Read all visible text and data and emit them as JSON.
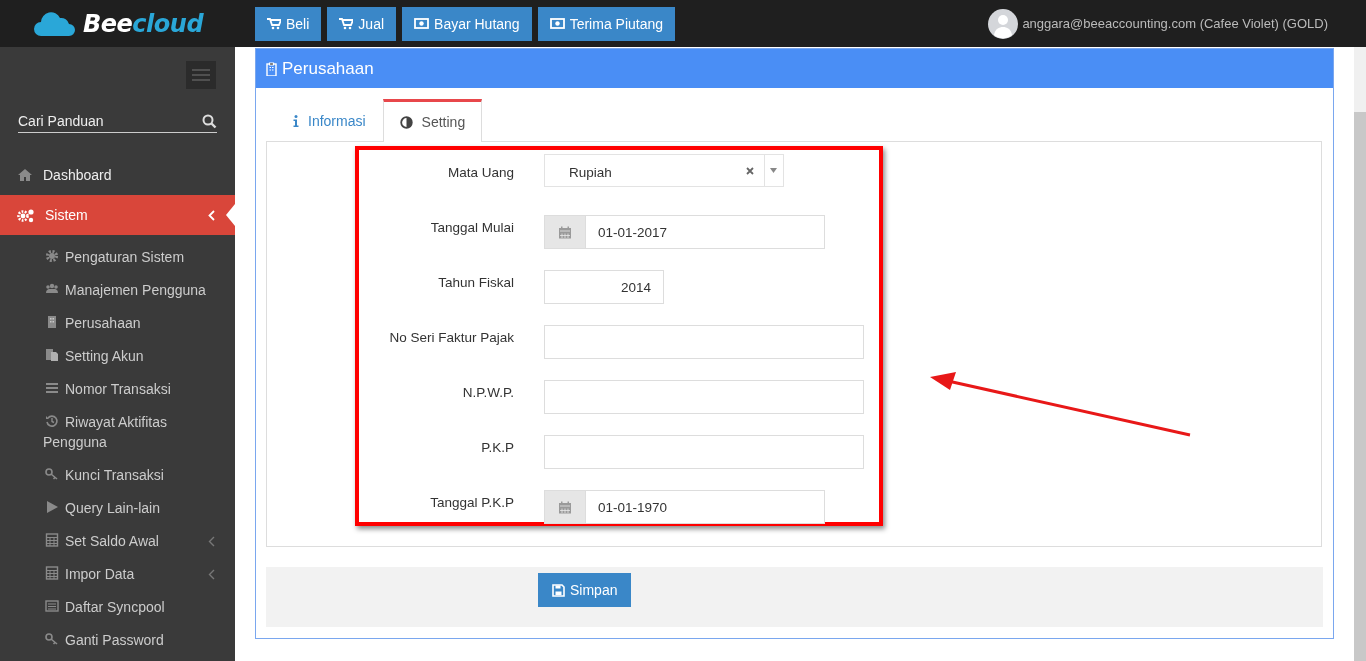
{
  "logo": {
    "parts": [
      "Bee",
      "cloud"
    ]
  },
  "toolbar": [
    {
      "label": "Beli",
      "kind": "cart"
    },
    {
      "label": "Jual",
      "kind": "cart"
    },
    {
      "label": "Bayar Hutang",
      "kind": "money"
    },
    {
      "label": "Terima Piutang",
      "kind": "money"
    }
  ],
  "user": {
    "label": "anggara@beeaccounting.com (Cafee Violet) (GOLD)"
  },
  "sidebar": {
    "search": {
      "placeholder": "Cari Panduan"
    },
    "items": [
      {
        "label": "Dashboard",
        "selected": false,
        "submenu": false
      },
      {
        "label": "Sistem",
        "selected": true,
        "submenu": true,
        "children": [
          {
            "label": "Pengaturan Sistem",
            "submenu": false
          },
          {
            "label": "Manajemen Pengguna",
            "submenu": false
          },
          {
            "label": "Perusahaan",
            "submenu": false
          },
          {
            "label": "Setting Akun",
            "submenu": false
          },
          {
            "label": "Nomor Transaksi",
            "submenu": false
          },
          {
            "label": "Riwayat Aktifitas Pengguna",
            "submenu": false
          },
          {
            "label": "Kunci Transaksi",
            "submenu": false
          },
          {
            "label": "Query Lain-lain",
            "submenu": false
          },
          {
            "label": "Set Saldo Awal",
            "submenu": true
          },
          {
            "label": "Impor Data",
            "submenu": true
          },
          {
            "label": "Daftar Syncpool",
            "submenu": false
          },
          {
            "label": "Ganti Password",
            "submenu": false
          }
        ]
      }
    ]
  },
  "panel": {
    "title": "Perusahaan",
    "tabs": [
      {
        "label": "Informasi",
        "selected": false
      },
      {
        "label": "Setting",
        "selected": true
      }
    ],
    "form": [
      {
        "kind": "select",
        "label": "Mata Uang",
        "value": "Rupiah"
      },
      {
        "kind": "date",
        "label": "Tanggal Mulai",
        "value": "01-01-2017"
      },
      {
        "kind": "number",
        "label": "Tahun Fiskal",
        "value": "2014"
      },
      {
        "kind": "text",
        "label": "No Seri Faktur Pajak"
      },
      {
        "kind": "text",
        "label": "N.P.W.P."
      },
      {
        "kind": "text",
        "label": "P.K.P"
      },
      {
        "kind": "date",
        "label": "Tanggal P.K.P",
        "value": "01-01-1970"
      }
    ],
    "save_button": {
      "label": "Simpan"
    }
  }
}
